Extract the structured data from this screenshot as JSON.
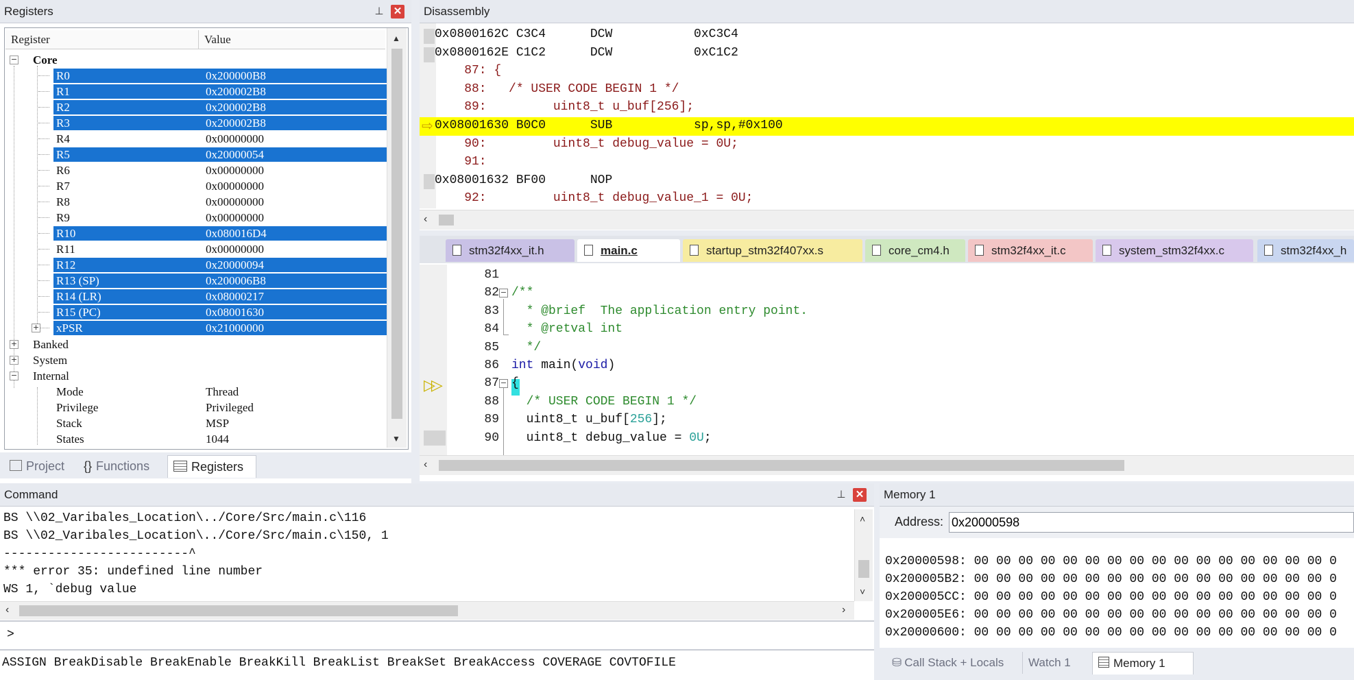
{
  "registers": {
    "title": "Registers",
    "columns": [
      "Register",
      "Value"
    ],
    "core_label": "Core",
    "rows": [
      {
        "name": "R0",
        "value": "0x200000B8",
        "selected": true
      },
      {
        "name": "R1",
        "value": "0x200002B8",
        "selected": true
      },
      {
        "name": "R2",
        "value": "0x200002B8",
        "selected": true
      },
      {
        "name": "R3",
        "value": "0x200002B8",
        "selected": true
      },
      {
        "name": "R4",
        "value": "0x00000000",
        "selected": false
      },
      {
        "name": "R5",
        "value": "0x20000054",
        "selected": true
      },
      {
        "name": "R6",
        "value": "0x00000000",
        "selected": false
      },
      {
        "name": "R7",
        "value": "0x00000000",
        "selected": false
      },
      {
        "name": "R8",
        "value": "0x00000000",
        "selected": false
      },
      {
        "name": "R9",
        "value": "0x00000000",
        "selected": false
      },
      {
        "name": "R10",
        "value": "0x080016D4",
        "selected": true
      },
      {
        "name": "R11",
        "value": "0x00000000",
        "selected": false
      },
      {
        "name": "R12",
        "value": "0x20000094",
        "selected": true
      },
      {
        "name": "R13 (SP)",
        "value": "0x200006B8",
        "selected": true
      },
      {
        "name": "R14 (LR)",
        "value": "0x08000217",
        "selected": true
      },
      {
        "name": "R15 (PC)",
        "value": "0x08001630",
        "selected": true
      },
      {
        "name": "xPSR",
        "value": "0x21000000",
        "selected": true
      }
    ],
    "groups": [
      "Banked",
      "System",
      "Internal"
    ],
    "internal": [
      {
        "name": "Mode",
        "value": "Thread"
      },
      {
        "name": "Privilege",
        "value": "Privileged"
      },
      {
        "name": "Stack",
        "value": "MSP"
      },
      {
        "name": "States",
        "value": "1044"
      }
    ],
    "bottom_tabs": [
      "Project",
      "Functions",
      "Registers"
    ]
  },
  "disassembly": {
    "title": "Disassembly",
    "lines": [
      {
        "text": "0x0800162C C3C4      DCW           0xC3C4",
        "type": "asm"
      },
      {
        "text": "0x0800162E C1C2      DCW           0xC1C2",
        "type": "asm"
      },
      {
        "text": "    87: {",
        "type": "src"
      },
      {
        "text": "    88:   /* USER CODE BEGIN 1 */",
        "type": "src"
      },
      {
        "text": "    89:         uint8_t u_buf[256];",
        "type": "src"
      },
      {
        "text": "0x08001630 B0C0      SUB           sp,sp,#0x100",
        "type": "asm"
      },
      {
        "text": "    90:         uint8_t debug_value = 0U;",
        "type": "src"
      },
      {
        "text": "    91:",
        "type": "src"
      },
      {
        "text": "0x08001632 BF00      NOP",
        "type": "asm"
      },
      {
        "text": "    92:         uint8_t debug_value_1 = 0U;",
        "type": "src"
      }
    ]
  },
  "editor": {
    "tabs": [
      {
        "label": "stm32f4xx_it.h",
        "color": "#c9c1e6",
        "active": false
      },
      {
        "label": "main.c",
        "color": "#ffffff",
        "active": true
      },
      {
        "label": "startup_stm32f407xx.s",
        "color": "#f7eca0",
        "active": false
      },
      {
        "label": "core_cm4.h",
        "color": "#cfe8c0",
        "active": false
      },
      {
        "label": "stm32f4xx_it.c",
        "color": "#f3c6c6",
        "active": false
      },
      {
        "label": "system_stm32f4xx.c",
        "color": "#d8c8ec",
        "active": false
      },
      {
        "label": "stm32f4xx_h",
        "color": "#c9d6f0",
        "active": false
      }
    ],
    "lines": [
      {
        "num": "81",
        "code": ""
      },
      {
        "num": "82",
        "code": "/**"
      },
      {
        "num": "83",
        "code": "  * @brief  The application entry point."
      },
      {
        "num": "84",
        "code": "  * @retval int"
      },
      {
        "num": "85",
        "code": "  */"
      },
      {
        "num": "86",
        "code_a": "int",
        "code_b": " main(",
        "code_c": "void",
        "code_d": ")"
      },
      {
        "num": "87",
        "code": "{"
      },
      {
        "num": "88",
        "code": "  /* USER CODE BEGIN 1 */"
      },
      {
        "num": "89",
        "code_a": "  uint8_t u_buf[",
        "code_b": "256",
        "code_c": "];"
      },
      {
        "num": "90",
        "code_a": "  uint8_t debug_value = ",
        "code_b": "0U",
        "code_c": ";"
      }
    ]
  },
  "command": {
    "title": "Command",
    "lines": [
      "BS \\\\02_Varibales_Location\\../Core/Src/main.c\\116",
      "BS \\\\02_Varibales_Location\\../Core/Src/main.c\\150, 1",
      "-------------------------^",
      "*** error 35: undefined line number",
      "WS 1, `debug value"
    ],
    "prompt": ">",
    "hints": "ASSIGN BreakDisable BreakEnable BreakKill BreakList BreakSet BreakAccess COVERAGE COVTOFILE"
  },
  "memory": {
    "title": "Memory 1",
    "address_label": "Address:",
    "address_value": "0x20000598",
    "rows": [
      "0x20000598: 00 00 00 00 00 00 00 00 00 00 00 00 00 00 00 00 0",
      "0x200005B2: 00 00 00 00 00 00 00 00 00 00 00 00 00 00 00 00 0",
      "0x200005CC: 00 00 00 00 00 00 00 00 00 00 00 00 00 00 00 00 0",
      "0x200005E6: 00 00 00 00 00 00 00 00 00 00 00 00 00 00 00 00 0",
      "0x20000600: 00 00 00 00 00 00 00 00 00 00 00 00 00 00 00 00 0"
    ],
    "bottom_tabs": [
      "Call Stack + Locals",
      "Watch 1",
      "Memory 1"
    ]
  }
}
